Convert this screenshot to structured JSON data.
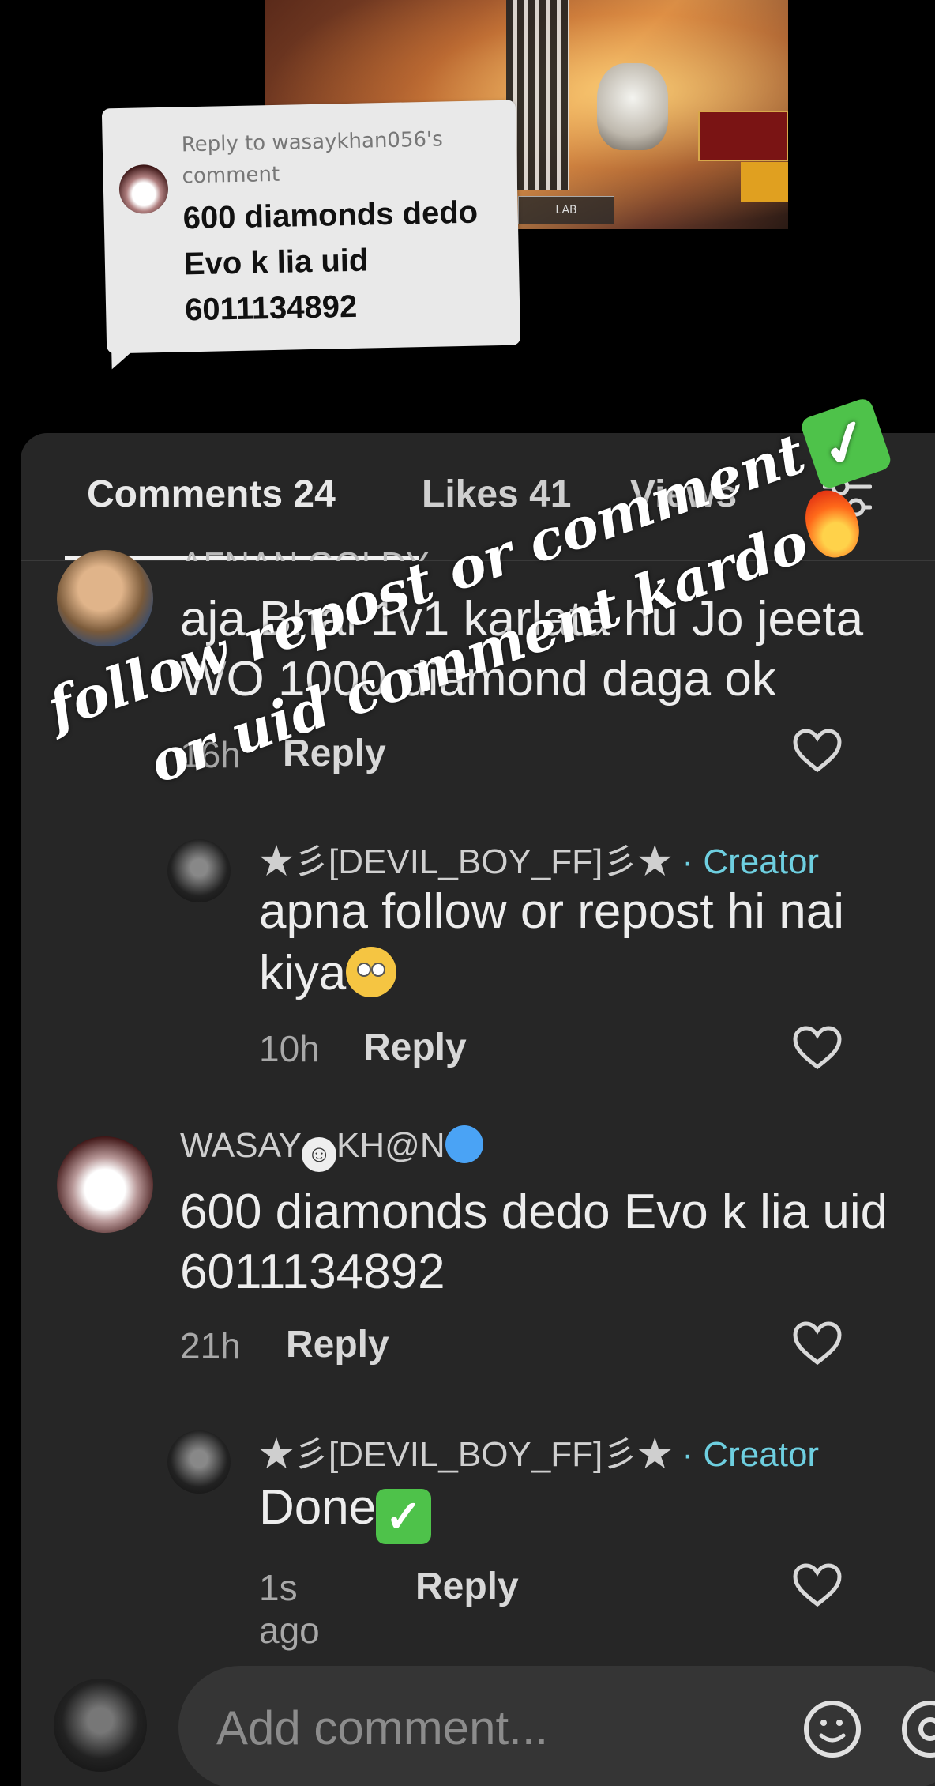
{
  "video": {
    "hud_label": "LAB"
  },
  "sticker": {
    "reply_to": "Reply to wasaykhan056's comment",
    "text": "600 diamonds dedo Evo k lia uid 6011134892"
  },
  "tabs": {
    "comments": "Comments 24",
    "likes": "Likes 41",
    "views": "Views"
  },
  "comments": [
    {
      "name": "AFNAN GOLDY",
      "text_line1": "aja Bhai 1v1 karlata hu Jo jeeta",
      "text_line2": "WO 1000 diamond daga ok",
      "time": "16h",
      "reply": "Reply"
    },
    {
      "name": "★彡[DEVIL_BOY_FF]彡★",
      "creator": "· Creator",
      "text_line1": "apna follow or repost hi nai",
      "text_line2": "kiya",
      "time": "10h",
      "reply": "Reply"
    },
    {
      "name_part1": "WASAY",
      "name_part2": "KH@N",
      "text_line1": "600 diamonds dedo Evo k lia uid",
      "text_line2": "6011134892",
      "time": "21h",
      "reply": "Reply"
    },
    {
      "name": "★彡[DEVIL_BOY_FF]彡★",
      "creator": "· Creator",
      "text": "Done",
      "time": "1s ago",
      "reply": "Reply"
    }
  ],
  "input": {
    "placeholder": "Add comment..."
  },
  "overlay": {
    "line1": "follow repost or comment",
    "line2": "or uid comment kardo"
  },
  "colors": {
    "panel_bg": "#262626",
    "creator": "#6ecfe0",
    "check_green": "#4ec24a"
  }
}
